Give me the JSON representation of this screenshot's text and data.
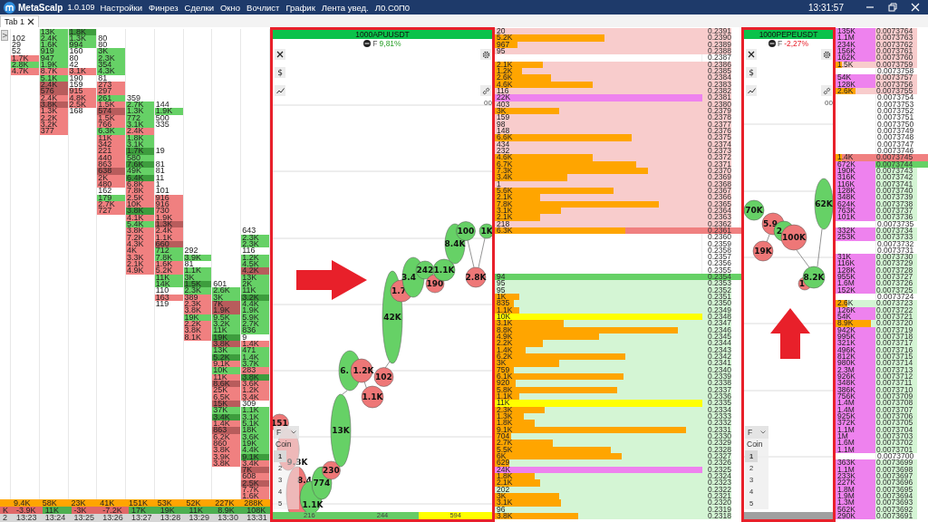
{
  "app": {
    "name": "MetaScalp",
    "version": "1.0.109",
    "menu": [
      "Настройки",
      "Финрез",
      "Сделки",
      "Окно",
      "Вочлист",
      "График",
      "Лента увед.",
      "Л0.С0П0"
    ],
    "clock": "13:31:57"
  },
  "tabs": [
    {
      "label": "Tab 1",
      "selected": true
    }
  ],
  "cluster": {
    "toggle": ">",
    "columns": [
      {
        "kind": "partial",
        "delta": {
          "value": "K",
          "kind": "sell"
        },
        "time": "2"
      },
      {
        "kind": "full",
        "cells": [
          null,
          {
            "v": "102",
            "kind": "plain"
          },
          {
            "v": "29",
            "kind": "plain"
          },
          {
            "v": "52",
            "kind": "plain"
          },
          {
            "v": "1.7K",
            "kind": "sell"
          },
          {
            "v": "2.8K",
            "kind": "buy"
          },
          {
            "v": "4.7K",
            "kind": "sell"
          }
        ],
        "volume": "9.4K",
        "delta": {
          "value": "-3.9K",
          "kind": "sell"
        },
        "time": "13:23"
      },
      {
        "kind": "full",
        "cells": [
          {
            "v": "13K",
            "kind": "buy"
          },
          {
            "v": "2.4K",
            "kind": "buy"
          },
          {
            "v": "1.6K",
            "kind": "buy"
          },
          {
            "v": "919",
            "kind": "buy"
          },
          {
            "v": "947",
            "kind": "buy"
          },
          {
            "v": "1.9K",
            "kind": "buy"
          },
          {
            "v": "8.7K",
            "kind": "sell"
          },
          {
            "v": "5.1K",
            "kind": "buy"
          },
          {
            "v": "2.4K",
            "kind": "sell-dark"
          },
          {
            "v": "576",
            "kind": "sell-dark"
          },
          {
            "v": "2.4K",
            "kind": "sell"
          },
          {
            "v": "3.8K",
            "kind": "sell-dark"
          },
          {
            "v": "1.3K",
            "kind": "sell"
          },
          {
            "v": "2.2K",
            "kind": "sell"
          },
          {
            "v": "3.2K",
            "kind": "sell"
          },
          {
            "v": "377",
            "kind": "sell"
          }
        ],
        "volume": "58K",
        "delta": {
          "value": "11K",
          "kind": "buy"
        },
        "time": "13:24"
      },
      {
        "kind": "full",
        "cells": [
          {
            "v": "1.8K",
            "kind": "buy-dark"
          },
          {
            "v": "1.3K",
            "kind": "buy"
          },
          {
            "v": "994",
            "kind": "buy"
          },
          {
            "v": "160",
            "kind": "plain"
          },
          {
            "v": "80",
            "kind": "plain"
          },
          {
            "v": "42",
            "kind": "plain"
          },
          {
            "v": "3.1K",
            "kind": "sell"
          },
          {
            "v": "190",
            "kind": "plain"
          },
          {
            "v": "159",
            "kind": "plain"
          },
          {
            "v": "915",
            "kind": "sell"
          },
          {
            "v": "4.8K",
            "kind": "sell"
          },
          {
            "v": "2.5K",
            "kind": "sell"
          },
          {
            "v": "168",
            "kind": "plain"
          }
        ],
        "volume": "23K",
        "delta": {
          "value": "-3K",
          "kind": "sell"
        },
        "time": "13:25"
      },
      {
        "kind": "full",
        "cells": [
          null,
          {
            "v": "80",
            "kind": "plain"
          },
          {
            "v": "80",
            "kind": "plain"
          },
          {
            "v": "3K",
            "kind": "buy"
          },
          {
            "v": "2.3K",
            "kind": "buy"
          },
          {
            "v": "354",
            "kind": "buy"
          },
          {
            "v": "4.3K",
            "kind": "buy"
          },
          {
            "v": "81",
            "kind": "plain"
          },
          {
            "v": "273",
            "kind": "sell"
          },
          {
            "v": "297",
            "kind": "sell"
          },
          {
            "v": "261",
            "kind": "buy"
          },
          {
            "v": "1.5K",
            "kind": "sell"
          },
          {
            "v": "574",
            "kind": "sell-dark"
          },
          {
            "v": "1.5K",
            "kind": "sell"
          },
          {
            "v": "766",
            "kind": "sell"
          },
          {
            "v": "6.3K",
            "kind": "buy"
          },
          {
            "v": "11K",
            "kind": "sell"
          },
          {
            "v": "342",
            "kind": "sell"
          },
          {
            "v": "221",
            "kind": "sell"
          },
          {
            "v": "440",
            "kind": "sell"
          },
          {
            "v": "863",
            "kind": "sell"
          },
          {
            "v": "638",
            "kind": "sell-dark"
          },
          {
            "v": "2K",
            "kind": "sell"
          },
          {
            "v": "480",
            "kind": "sell"
          },
          {
            "v": "162",
            "kind": "plain"
          },
          {
            "v": "179",
            "kind": "buy"
          },
          {
            "v": "2.7K",
            "kind": "sell"
          },
          {
            "v": "727",
            "kind": "sell"
          }
        ],
        "volume": "41K",
        "delta": {
          "value": "-7.2K",
          "kind": "sell"
        },
        "time": "13:26"
      },
      {
        "kind": "full",
        "cells": [
          null,
          null,
          null,
          null,
          null,
          null,
          null,
          null,
          null,
          null,
          {
            "v": "359",
            "kind": "plain"
          },
          {
            "v": "2.7K",
            "kind": "buy"
          },
          {
            "v": "1.3K",
            "kind": "buy"
          },
          {
            "v": "772",
            "kind": "buy"
          },
          {
            "v": "3.1K",
            "kind": "buy"
          },
          {
            "v": "2.4K",
            "kind": "sell"
          },
          {
            "v": "1.8K",
            "kind": "buy"
          },
          {
            "v": "3.1K",
            "kind": "buy"
          },
          {
            "v": "1.7K",
            "kind": "buy-dark"
          },
          {
            "v": "580",
            "kind": "buy"
          },
          {
            "v": "7.6K",
            "kind": "buy-dark"
          },
          {
            "v": "49K",
            "kind": "buy"
          },
          {
            "v": "6.4K",
            "kind": "buy-dark"
          },
          {
            "v": "6.8K",
            "kind": "sell"
          },
          {
            "v": "7.8K",
            "kind": "sell"
          },
          {
            "v": "2.5K",
            "kind": "sell"
          },
          {
            "v": "10K",
            "kind": "sell"
          },
          {
            "v": "3.8K",
            "kind": "buy-dark"
          },
          {
            "v": "4.1K",
            "kind": "sell"
          },
          {
            "v": "5.4K",
            "kind": "buy"
          },
          {
            "v": "3.8K",
            "kind": "sell"
          },
          {
            "v": "7.2K",
            "kind": "sell"
          },
          {
            "v": "4.3K",
            "kind": "sell"
          },
          {
            "v": "4K",
            "kind": "sell"
          },
          {
            "v": "3.3K",
            "kind": "sell"
          },
          {
            "v": "2.1K",
            "kind": "sell"
          },
          {
            "v": "4.9K",
            "kind": "sell"
          }
        ],
        "volume": "151K",
        "delta": {
          "value": "17K",
          "kind": "buy"
        },
        "time": "13:27"
      },
      {
        "kind": "full",
        "cells": [
          null,
          null,
          null,
          null,
          null,
          null,
          null,
          null,
          null,
          null,
          null,
          {
            "v": "144",
            "kind": "plain"
          },
          {
            "v": "1.9K",
            "kind": "buy"
          },
          {
            "v": "500",
            "kind": "plain"
          },
          {
            "v": "335",
            "kind": "plain"
          },
          null,
          null,
          null,
          {
            "v": "19",
            "kind": "plain"
          },
          null,
          {
            "v": "81",
            "kind": "plain"
          },
          {
            "v": "81",
            "kind": "plain"
          },
          {
            "v": "11",
            "kind": "plain"
          },
          {
            "v": "1",
            "kind": "plain"
          },
          {
            "v": "101",
            "kind": "plain"
          },
          {
            "v": "916",
            "kind": "sell"
          },
          {
            "v": "916",
            "kind": "sell"
          },
          {
            "v": "730",
            "kind": "sell"
          },
          {
            "v": "1.9K",
            "kind": "sell"
          },
          {
            "v": "1.3K",
            "kind": "sell-dark"
          },
          {
            "v": "2.4K",
            "kind": "sell"
          },
          {
            "v": "1.1K",
            "kind": "sell"
          },
          {
            "v": "660",
            "kind": "sell-dark"
          },
          {
            "v": "712",
            "kind": "buy"
          },
          {
            "v": "7.8K",
            "kind": "buy"
          },
          {
            "v": "1.6K",
            "kind": "sell"
          },
          {
            "v": "5.2K",
            "kind": "sell"
          },
          {
            "v": "11K",
            "kind": "buy"
          },
          {
            "v": "14K",
            "kind": "buy"
          },
          {
            "v": "110",
            "kind": "plain"
          },
          {
            "v": "163",
            "kind": "sell"
          },
          {
            "v": "119",
            "kind": "plain"
          }
        ],
        "volume": "53K",
        "delta": {
          "value": "19K",
          "kind": "buy"
        },
        "time": "13:28"
      },
      {
        "kind": "full",
        "cells": [
          null,
          null,
          null,
          null,
          null,
          null,
          null,
          null,
          null,
          null,
          null,
          null,
          null,
          null,
          null,
          null,
          null,
          null,
          null,
          null,
          null,
          null,
          null,
          null,
          null,
          null,
          null,
          null,
          null,
          null,
          null,
          null,
          null,
          {
            "v": "292",
            "kind": "plain"
          },
          {
            "v": "3.9K",
            "kind": "buy"
          },
          {
            "v": "81",
            "kind": "plain"
          },
          {
            "v": "1.1K",
            "kind": "buy"
          },
          {
            "v": "3K",
            "kind": "buy"
          },
          {
            "v": "1.5K",
            "kind": "buy-dark"
          },
          {
            "v": "2.3K",
            "kind": "buy"
          },
          {
            "v": "389",
            "kind": "sell"
          },
          {
            "v": "2.3K",
            "kind": "sell"
          },
          {
            "v": "3.8K",
            "kind": "sell"
          },
          {
            "v": "19K",
            "kind": "buy"
          },
          {
            "v": "2.2K",
            "kind": "sell"
          },
          {
            "v": "3.8K",
            "kind": "sell"
          },
          {
            "v": "8.1K",
            "kind": "sell"
          }
        ],
        "volume": "52K",
        "delta": {
          "value": "11K",
          "kind": "buy"
        },
        "time": "13:29"
      },
      {
        "kind": "full",
        "cells": [
          null,
          null,
          null,
          null,
          null,
          null,
          null,
          null,
          null,
          null,
          null,
          null,
          null,
          null,
          null,
          null,
          null,
          null,
          null,
          null,
          null,
          null,
          null,
          null,
          null,
          null,
          null,
          null,
          null,
          null,
          null,
          null,
          null,
          null,
          null,
          null,
          null,
          null,
          {
            "v": "601",
            "kind": "plain"
          },
          {
            "v": "2.6K",
            "kind": "buy"
          },
          {
            "v": "3K",
            "kind": "buy"
          },
          {
            "v": "7K",
            "kind": "sell-dark"
          },
          {
            "v": "1.9K",
            "kind": "sell-dark"
          },
          {
            "v": "9.5K",
            "kind": "buy"
          },
          {
            "v": "3.2K",
            "kind": "buy"
          },
          {
            "v": "11K",
            "kind": "buy"
          },
          {
            "v": "19K",
            "kind": "buy-dark"
          },
          {
            "v": "3.8K",
            "kind": "sell-dark"
          },
          {
            "v": "13K",
            "kind": "buy"
          },
          {
            "v": "5.2K",
            "kind": "buy-dark"
          },
          {
            "v": "9.1K",
            "kind": "sell"
          },
          {
            "v": "10K",
            "kind": "buy"
          },
          {
            "v": "11K",
            "kind": "sell"
          },
          {
            "v": "8.6K",
            "kind": "sell-dark"
          },
          {
            "v": "25K",
            "kind": "sell"
          },
          {
            "v": "6.5K",
            "kind": "sell"
          },
          {
            "v": "15K",
            "kind": "sell-dark"
          },
          {
            "v": "37K",
            "kind": "buy"
          },
          {
            "v": "3.4K",
            "kind": "buy-dark"
          },
          {
            "v": "1.4K",
            "kind": "sell"
          },
          {
            "v": "863",
            "kind": "sell-dark"
          },
          {
            "v": "6.2K",
            "kind": "sell"
          },
          {
            "v": "860",
            "kind": "sell"
          },
          {
            "v": "3.8K",
            "kind": "sell"
          },
          {
            "v": "3.9K",
            "kind": "sell"
          },
          {
            "v": "3.8K",
            "kind": "sell"
          }
        ],
        "volume": "227K",
        "delta": {
          "value": "8.9K",
          "kind": "buy"
        },
        "time": "13:30"
      },
      {
        "kind": "full",
        "cells": [
          null,
          null,
          null,
          null,
          null,
          null,
          null,
          null,
          null,
          null,
          null,
          null,
          null,
          null,
          null,
          null,
          null,
          null,
          null,
          null,
          null,
          null,
          null,
          null,
          null,
          null,
          null,
          null,
          null,
          null,
          {
            "v": "643",
            "kind": "plain"
          },
          {
            "v": "2.3K",
            "kind": "buy"
          },
          {
            "v": "2.3K",
            "kind": "buy"
          },
          {
            "v": "116",
            "kind": "plain"
          },
          {
            "v": "1.2K",
            "kind": "buy"
          },
          {
            "v": "4.5K",
            "kind": "buy"
          },
          {
            "v": "4.2K",
            "kind": "sell-dark"
          },
          {
            "v": "13K",
            "kind": "buy"
          },
          {
            "v": "2K",
            "kind": "buy"
          },
          {
            "v": "11K",
            "kind": "buy"
          },
          {
            "v": "3.2K",
            "kind": "buy-dark"
          },
          {
            "v": "4.4K",
            "kind": "buy"
          },
          {
            "v": "1.9K",
            "kind": "buy"
          },
          {
            "v": "5.9K",
            "kind": "buy"
          },
          {
            "v": "2.7K",
            "kind": "buy"
          },
          {
            "v": "836",
            "kind": "buy"
          },
          {
            "v": "9",
            "kind": "plain"
          },
          {
            "v": "1.4K",
            "kind": "sell"
          },
          {
            "v": "471",
            "kind": "buy"
          },
          {
            "v": "1.4K",
            "kind": "buy"
          },
          {
            "v": "3.7K",
            "kind": "buy"
          },
          {
            "v": "283",
            "kind": "sell"
          },
          {
            "v": "3.8K",
            "kind": "buy-dark"
          },
          {
            "v": "3.6K",
            "kind": "sell"
          },
          {
            "v": "1.2K",
            "kind": "sell"
          },
          {
            "v": "3.4K",
            "kind": "sell"
          },
          {
            "v": "309",
            "kind": "plain"
          },
          {
            "v": "1.1K",
            "kind": "buy"
          },
          {
            "v": "3.1K",
            "kind": "buy"
          },
          {
            "v": "5.1K",
            "kind": "buy"
          },
          {
            "v": "18K",
            "kind": "buy"
          },
          {
            "v": "3.6K",
            "kind": "buy"
          },
          {
            "v": "19K",
            "kind": "buy"
          },
          {
            "v": "4.4K",
            "kind": "buy"
          },
          {
            "v": "9.1K",
            "kind": "buy-dark"
          },
          {
            "v": "3.4K",
            "kind": "sell"
          },
          {
            "v": "7K",
            "kind": "sell-dark"
          },
          {
            "v": "608",
            "kind": "sell"
          },
          {
            "v": "2.5K",
            "kind": "sell-dark"
          },
          {
            "v": "7.7K",
            "kind": "sell"
          },
          {
            "v": "1.6K",
            "kind": "sell"
          }
        ],
        "volume": "288K",
        "delta": {
          "value": "108K",
          "kind": "buy"
        },
        "time": "13:31"
      }
    ]
  },
  "chart_panels": [
    {
      "symbol": "1000APUUSDT",
      "market": "F",
      "change": "9,81%",
      "rising": true,
      "dollar": "$",
      "link_value": "00",
      "selector": "F",
      "unit": "Coin",
      "levels": [
        {
          "label": "1",
          "selected": true
        },
        {
          "label": "2",
          "selected": false
        },
        {
          "label": "3",
          "selected": false
        },
        {
          "label": "4",
          "selected": false
        },
        {
          "label": "5",
          "selected": false
        }
      ],
      "bubbles": [
        {
          "label": "151",
          "kind": "sell"
        },
        {
          "label": "9.3K",
          "kind": "sell"
        },
        {
          "label": "8.4",
          "kind": "sell"
        },
        {
          "label": "1.1K",
          "kind": "buy"
        },
        {
          "label": "774",
          "kind": "buy"
        },
        {
          "label": "230",
          "kind": "sell"
        },
        {
          "label": "13K",
          "kind": "buy"
        },
        {
          "label": "6.",
          "kind": "buy"
        },
        {
          "label": "1.2K",
          "kind": "sell"
        },
        {
          "label": "1.1K",
          "kind": "sell"
        },
        {
          "label": "102",
          "kind": "sell"
        },
        {
          "label": "42K",
          "kind": "buy"
        },
        {
          "label": "1.7",
          "kind": "sell"
        },
        {
          "label": "3.4",
          "kind": "buy"
        },
        {
          "label": "242",
          "kind": "buy"
        },
        {
          "label": "190",
          "kind": "sell"
        },
        {
          "label": "1.1K",
          "kind": "buy"
        },
        {
          "label": "8.4K",
          "kind": "buy"
        },
        {
          "label": "100",
          "kind": "buy"
        },
        {
          "label": "1K",
          "kind": "buy"
        },
        {
          "label": "2.8K",
          "kind": "sell"
        }
      ],
      "strip": [
        {
          "label": "216",
          "color": "#66cc66"
        },
        {
          "label": "244",
          "color": "#66cc66"
        },
        {
          "label": "594",
          "color": "#ffff00"
        }
      ]
    },
    {
      "symbol": "1000PEPEUSDT",
      "market": "F",
      "change": "-2,27%",
      "rising": false,
      "dollar": "$",
      "link_value": "00",
      "selector": "F",
      "unit": "Coin",
      "levels": [
        {
          "label": "1",
          "selected": true
        },
        {
          "label": "2",
          "selected": false
        },
        {
          "label": "3",
          "selected": false
        },
        {
          "label": "4",
          "selected": false
        },
        {
          "label": "5",
          "selected": false
        }
      ],
      "bubbles": [
        {
          "label": "70K",
          "kind": "buy"
        },
        {
          "label": "19K",
          "kind": "sell"
        },
        {
          "label": "5.9",
          "kind": "sell"
        },
        {
          "label": "2",
          "kind": "buy"
        },
        {
          "label": "100K",
          "kind": "sell"
        },
        {
          "label": "62K",
          "kind": "buy"
        },
        {
          "label": "1",
          "kind": "sell"
        },
        {
          "label": "8.2K",
          "kind": "buy"
        }
      ]
    }
  ],
  "order_books": [
    {
      "rows": [
        {
          "price": "0.2391",
          "vol": "20",
          "kind": "ask"
        },
        {
          "price": "0.2390",
          "vol": "5.2K",
          "kind": "ask",
          "level": 0.53
        },
        {
          "price": "0.2389",
          "vol": "967",
          "kind": "ask",
          "level": 0.11
        },
        {
          "price": "0.2388",
          "vol": "95",
          "kind": "ask"
        },
        {
          "price": "0.2387",
          "kind": "gap"
        },
        {
          "price": "0.2386",
          "vol": "2.1K",
          "kind": "ask",
          "level": 0.23
        },
        {
          "price": "0.2385",
          "vol": "1.2K",
          "kind": "ask",
          "level": 0.13
        },
        {
          "price": "0.2384",
          "vol": "2.6K",
          "kind": "ask",
          "level": 0.27
        },
        {
          "price": "0.2383",
          "vol": "4.6K",
          "kind": "ask",
          "level": 0.47
        },
        {
          "price": "0.2382",
          "vol": "116",
          "kind": "ask"
        },
        {
          "price": "0.2381",
          "vol": "22K",
          "kind": "ask-large"
        },
        {
          "price": "0.2380",
          "vol": "403",
          "kind": "ask"
        },
        {
          "price": "0.2379",
          "vol": "3K",
          "kind": "ask",
          "level": 0.31
        },
        {
          "price": "0.2378",
          "vol": "159",
          "kind": "ask"
        },
        {
          "price": "0.2377",
          "vol": "98",
          "kind": "ask"
        },
        {
          "price": "0.2376",
          "vol": "148",
          "kind": "ask"
        },
        {
          "price": "0.2375",
          "vol": "6.6K",
          "kind": "ask",
          "level": 0.66
        },
        {
          "price": "0.2374",
          "vol": "434",
          "kind": "ask"
        },
        {
          "price": "0.2373",
          "vol": "232",
          "kind": "ask"
        },
        {
          "price": "0.2372",
          "vol": "4.6K",
          "kind": "ask",
          "level": 0.47
        },
        {
          "price": "0.2371",
          "vol": "6.7K",
          "kind": "ask",
          "level": 0.68
        },
        {
          "price": "0.2370",
          "vol": "7.3K",
          "kind": "ask",
          "level": 0.74
        },
        {
          "price": "0.2369",
          "vol": "3.4K",
          "kind": "ask",
          "level": 0.35
        },
        {
          "price": "0.2368",
          "vol": "1",
          "kind": "ask"
        },
        {
          "price": "0.2367",
          "vol": "5.6K",
          "kind": "ask",
          "level": 0.57
        },
        {
          "price": "0.2366",
          "vol": "2.1K",
          "kind": "ask",
          "level": 0.22
        },
        {
          "price": "0.2365",
          "vol": "7.8K",
          "kind": "ask",
          "level": 0.79
        },
        {
          "price": "0.2364",
          "vol": "3.1K",
          "kind": "ask",
          "level": 0.32
        },
        {
          "price": "0.2363",
          "vol": "2.1K",
          "kind": "ask",
          "level": 0.22
        },
        {
          "price": "0.2362",
          "vol": "218",
          "kind": "ask"
        },
        {
          "price": "0.2361",
          "vol": "6.3K",
          "kind": "ask-best",
          "level": 0.63
        },
        {
          "price": "0.2360",
          "kind": "gap"
        },
        {
          "price": "0.2359",
          "kind": "gap"
        },
        {
          "price": "0.2358",
          "kind": "gap"
        },
        {
          "price": "0.2357",
          "kind": "gap"
        },
        {
          "price": "0.2356",
          "kind": "gap"
        },
        {
          "price": "0.2355",
          "kind": "gap"
        },
        {
          "price": "0.2354",
          "vol": "94",
          "kind": "bid-best"
        },
        {
          "price": "0.2353",
          "vol": "95",
          "kind": "bid"
        },
        {
          "price": "0.2352",
          "vol": "95",
          "kind": "bid"
        },
        {
          "price": "0.2351",
          "vol": "1K",
          "kind": "bid",
          "level": 0.12
        },
        {
          "price": "0.2350",
          "vol": "835",
          "kind": "bid",
          "level": 0.09
        },
        {
          "price": "0.2349",
          "vol": "1.1K",
          "kind": "bid",
          "level": 0.12
        },
        {
          "price": "0.2348",
          "vol": "10K",
          "kind": "bid-wall"
        },
        {
          "price": "0.2347",
          "vol": "3.1K",
          "kind": "bid",
          "level": 0.33
        },
        {
          "price": "0.2346",
          "vol": "8.8K",
          "kind": "bid",
          "level": 0.88
        },
        {
          "price": "0.2345",
          "vol": "4.9K",
          "kind": "bid",
          "level": 0.5
        },
        {
          "price": "0.2344",
          "vol": "2.2K",
          "kind": "bid",
          "level": 0.23
        },
        {
          "price": "0.2343",
          "vol": "1.4K",
          "kind": "bid",
          "level": 0.15
        },
        {
          "price": "0.2342",
          "vol": "6.2K",
          "kind": "bid",
          "level": 0.63
        },
        {
          "price": "0.2341",
          "vol": "3K",
          "kind": "bid",
          "level": 0.31
        },
        {
          "price": "0.2340",
          "vol": "759",
          "kind": "bid",
          "level": 0.09
        },
        {
          "price": "0.2339",
          "vol": "6.1K",
          "kind": "bid",
          "level": 0.62
        },
        {
          "price": "0.2338",
          "vol": "920",
          "kind": "bid",
          "level": 0.1
        },
        {
          "price": "0.2337",
          "vol": "5.8K",
          "kind": "bid",
          "level": 0.59
        },
        {
          "price": "0.2336",
          "vol": "1.1K",
          "kind": "bid",
          "level": 0.12
        },
        {
          "price": "0.2335",
          "vol": "11K",
          "kind": "bid-wall"
        },
        {
          "price": "0.2334",
          "vol": "2.3K",
          "kind": "bid",
          "level": 0.24
        },
        {
          "price": "0.2333",
          "vol": "1.3K",
          "kind": "bid",
          "level": 0.14
        },
        {
          "price": "0.2332",
          "vol": "1.8K",
          "kind": "bid",
          "level": 0.19
        },
        {
          "price": "0.2331",
          "vol": "9.1K",
          "kind": "bid",
          "level": 0.92
        },
        {
          "price": "0.2330",
          "vol": "704",
          "kind": "bid",
          "level": 0.08
        },
        {
          "price": "0.2329",
          "vol": "2.7K",
          "kind": "bid",
          "level": 0.28
        },
        {
          "price": "0.2328",
          "vol": "5.5K",
          "kind": "bid",
          "level": 0.56
        },
        {
          "price": "0.2327",
          "vol": "6K",
          "kind": "bid",
          "level": 0.61
        },
        {
          "price": "0.2326",
          "vol": "629",
          "kind": "bid",
          "level": 0.07
        },
        {
          "price": "0.2325",
          "vol": "24K",
          "kind": "bid-large"
        },
        {
          "price": "0.2324",
          "vol": "1.8K",
          "kind": "bid",
          "level": 0.19
        },
        {
          "price": "0.2323",
          "vol": "2.1K",
          "kind": "bid",
          "level": 0.22
        },
        {
          "price": "0.2322",
          "vol": "202",
          "kind": "bid"
        },
        {
          "price": "0.2321",
          "vol": "3K",
          "kind": "bid",
          "level": 0.31
        },
        {
          "price": "0.2320",
          "vol": "3.1K",
          "kind": "bid",
          "level": 0.32
        },
        {
          "price": "0.2319",
          "vol": "96",
          "kind": "bid"
        },
        {
          "price": "0.2318",
          "vol": "3.8K",
          "kind": "bid",
          "level": 0.4
        }
      ]
    },
    {
      "rows": [
        {
          "price": "0.0073764",
          "vol": "135K",
          "kind": "ask-large"
        },
        {
          "price": "0.0073763",
          "vol": "1.1M",
          "kind": "ask-large"
        },
        {
          "price": "0.0073762",
          "vol": "234K",
          "kind": "ask-large"
        },
        {
          "price": "0.0073761",
          "vol": "156K",
          "kind": "ask-large"
        },
        {
          "price": "0.0073760",
          "vol": "162K",
          "kind": "ask-large"
        },
        {
          "price": "0.0073759",
          "vol": "1.5K",
          "kind": "ask",
          "level": 0.15
        },
        {
          "price": "0.0073758",
          "kind": "gap"
        },
        {
          "price": "0.0073757",
          "vol": "54K",
          "kind": "ask-large"
        },
        {
          "price": "0.0073756",
          "vol": "128K",
          "kind": "ask-large"
        },
        {
          "price": "0.0073755",
          "vol": "2.6K",
          "kind": "ask",
          "level": 0.49
        },
        {
          "price": "0.0073754",
          "kind": "gap"
        },
        {
          "price": "0.0073753",
          "kind": "gap"
        },
        {
          "price": "0.0073752",
          "kind": "gap"
        },
        {
          "price": "0.0073751",
          "kind": "gap"
        },
        {
          "price": "0.0073750",
          "kind": "gap"
        },
        {
          "price": "0.0073749",
          "kind": "gap"
        },
        {
          "price": "0.0073748",
          "kind": "gap"
        },
        {
          "price": "0.0073747",
          "kind": "gap"
        },
        {
          "price": "0.0073746",
          "kind": "gap"
        },
        {
          "price": "0.0073745",
          "vol": "1.4K",
          "kind": "ask-best",
          "level": 0.15
        },
        {
          "price": "0.0073744",
          "vol": "672K",
          "kind": "bid-best-large"
        },
        {
          "price": "0.0073743",
          "vol": "190K",
          "kind": "bid-large"
        },
        {
          "price": "0.0073742",
          "vol": "316K",
          "kind": "bid-large"
        },
        {
          "price": "0.0073741",
          "vol": "116K",
          "kind": "bid-large"
        },
        {
          "price": "0.0073740",
          "vol": "128K",
          "kind": "bid-large"
        },
        {
          "price": "0.0073739",
          "vol": "348K",
          "kind": "bid-large"
        },
        {
          "price": "0.0073738",
          "vol": "624K",
          "kind": "bid-large"
        },
        {
          "price": "0.0073737",
          "vol": "763K",
          "kind": "bid-large"
        },
        {
          "price": "0.0073736",
          "vol": "101K",
          "kind": "bid-large"
        },
        {
          "price": "0.0073735",
          "kind": "gap"
        },
        {
          "price": "0.0073734",
          "vol": "332K",
          "kind": "bid-large"
        },
        {
          "price": "0.0073733",
          "vol": "253K",
          "kind": "bid-large"
        },
        {
          "price": "0.0073732",
          "kind": "gap"
        },
        {
          "price": "0.0073731",
          "kind": "gap"
        },
        {
          "price": "0.0073730",
          "vol": "31K",
          "kind": "bid-large"
        },
        {
          "price": "0.0073729",
          "vol": "116K",
          "kind": "bid-large"
        },
        {
          "price": "0.0073728",
          "vol": "128K",
          "kind": "bid-large"
        },
        {
          "price": "0.0073727",
          "vol": "955K",
          "kind": "bid-large"
        },
        {
          "price": "0.0073726",
          "vol": "1.6M",
          "kind": "bid-large"
        },
        {
          "price": "0.0073725",
          "vol": "152K",
          "kind": "bid-large"
        },
        {
          "price": "0.0073724",
          "kind": "gap"
        },
        {
          "price": "0.0073723",
          "vol": "2.6K",
          "kind": "bid",
          "level": 0.29
        },
        {
          "price": "0.0073722",
          "vol": "126K",
          "kind": "bid-large"
        },
        {
          "price": "0.0073721",
          "vol": "54K",
          "kind": "bid-large"
        },
        {
          "price": "0.0073720",
          "vol": "8.9K",
          "kind": "bid",
          "level": 0.88
        },
        {
          "price": "0.0073719",
          "vol": "942K",
          "kind": "bid-large"
        },
        {
          "price": "0.0073718",
          "vol": "995K",
          "kind": "bid-large"
        },
        {
          "price": "0.0073717",
          "vol": "321K",
          "kind": "bid-large"
        },
        {
          "price": "0.0073716",
          "vol": "496K",
          "kind": "bid-large"
        },
        {
          "price": "0.0073715",
          "vol": "812K",
          "kind": "bid-large"
        },
        {
          "price": "0.0073714",
          "vol": "980K",
          "kind": "bid-large"
        },
        {
          "price": "0.0073713",
          "vol": "2.3M",
          "kind": "bid-large"
        },
        {
          "price": "0.0073712",
          "vol": "926K",
          "kind": "bid-large"
        },
        {
          "price": "0.0073711",
          "vol": "348K",
          "kind": "bid-large"
        },
        {
          "price": "0.0073710",
          "vol": "386K",
          "kind": "bid-large"
        },
        {
          "price": "0.0073709",
          "vol": "756K",
          "kind": "bid-large"
        },
        {
          "price": "0.0073708",
          "vol": "1.4M",
          "kind": "bid-large"
        },
        {
          "price": "0.0073707",
          "vol": "1.4M",
          "kind": "bid-large"
        },
        {
          "price": "0.0073706",
          "vol": "925K",
          "kind": "bid-large"
        },
        {
          "price": "0.0073705",
          "vol": "372K",
          "kind": "bid-large"
        },
        {
          "price": "0.0073704",
          "vol": "1.1M",
          "kind": "bid-large"
        },
        {
          "price": "0.0073703",
          "vol": "1M",
          "kind": "bid-large"
        },
        {
          "price": "0.0073702",
          "vol": "1.6M",
          "kind": "bid-large"
        },
        {
          "price": "0.0073701",
          "vol": "1.1M",
          "kind": "bid-large"
        },
        {
          "price": "0.0073700",
          "kind": "gap"
        },
        {
          "price": "0.0073699",
          "vol": "363K",
          "kind": "bid-large"
        },
        {
          "price": "0.0073698",
          "vol": "1.1M",
          "kind": "bid-large"
        },
        {
          "price": "0.0073697",
          "vol": "233K",
          "kind": "bid-large"
        },
        {
          "price": "0.0073696",
          "vol": "227K",
          "kind": "bid-large"
        },
        {
          "price": "0.0073695",
          "vol": "1.8M",
          "kind": "bid-large"
        },
        {
          "price": "0.0073694",
          "vol": "1.9M",
          "kind": "bid-large"
        },
        {
          "price": "0.0073693",
          "vol": "1.3M",
          "kind": "bid-large"
        },
        {
          "price": "0.0073692",
          "vol": "562K",
          "kind": "bid-large"
        },
        {
          "price": "0.0073691",
          "vol": "290K",
          "kind": "bid-large"
        }
      ]
    }
  ]
}
